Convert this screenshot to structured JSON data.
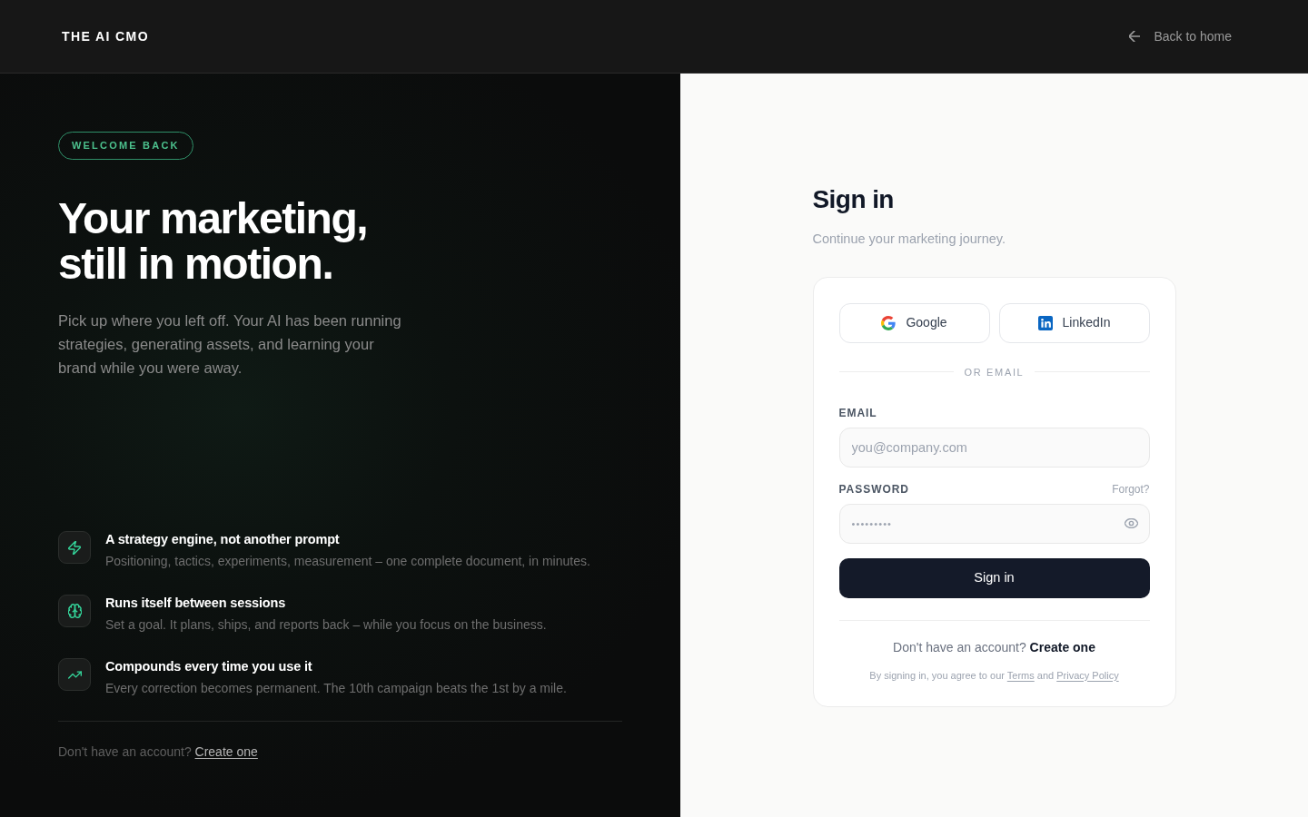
{
  "header": {
    "logo": "THE AI CMO",
    "back_link": "Back to home"
  },
  "hero": {
    "badge": "WELCOME BACK",
    "heading_lines": [
      "Your marketing,",
      "still in motion."
    ],
    "description": "Pick up where you left off. Your AI has been running strategies, generating assets, and learning your brand while you were away.",
    "features": [
      {
        "kind": "bolt",
        "title": "A strategy engine, not another prompt",
        "description": "Positioning, tactics, experiments, measurement – one complete document, in minutes."
      },
      {
        "kind": "brain",
        "title": "Runs itself between sessions",
        "description": "Set a goal. It plans, ships, and reports back – while you focus on the business."
      },
      {
        "kind": "trend",
        "title": "Compounds every time you use it",
        "description": "Every correction becomes permanent. The 10th campaign beats the 1st by a mile."
      }
    ],
    "footer": {
      "prompt": "Don't have an account?",
      "link": "Create one"
    }
  },
  "sign_in": {
    "title": "Sign in",
    "subtitle": "Continue your marketing journey.",
    "social_buttons": [
      {
        "kind": "google",
        "label": "Google"
      },
      {
        "kind": "linkedin",
        "label": "LinkedIn"
      }
    ],
    "divider": "OR EMAIL",
    "fields": [
      {
        "kind": "email",
        "label": "EMAIL",
        "placeholder": "you@company.com"
      },
      {
        "kind": "password",
        "label": "PASSWORD",
        "link": "Forgot?",
        "value": "•••••••••"
      }
    ],
    "submit": "Sign in",
    "signup": {
      "prompt": "Don't have an account?",
      "link": "Create one"
    },
    "legal": {
      "before": "By signing in, you agree to our",
      "terms": "Terms",
      "between": "and",
      "privacy": "Privacy Policy"
    }
  }
}
